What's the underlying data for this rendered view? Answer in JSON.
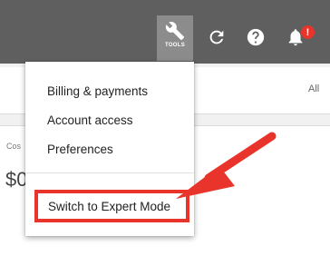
{
  "header": {
    "tools_label": "TOOLS",
    "notification_count": "!",
    "icons": [
      "wrench-icon",
      "refresh-icon",
      "help-icon",
      "bell-icon"
    ]
  },
  "background": {
    "all_link": "All",
    "cost_label": "Cos",
    "cost_value": "$0"
  },
  "tools_menu": {
    "items": [
      {
        "label": "Billing & payments"
      },
      {
        "label": "Account access"
      },
      {
        "label": "Preferences"
      }
    ],
    "expert_mode": "Switch to Expert Mode"
  },
  "colors": {
    "header_bg": "#5f5f5f",
    "tools_active_bg": "#8c8c8c",
    "highlight_red": "#e8342a"
  }
}
